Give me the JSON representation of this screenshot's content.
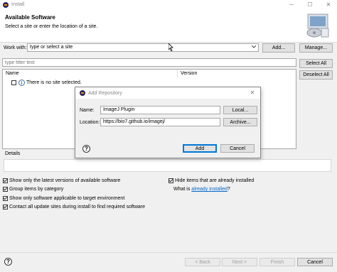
{
  "window": {
    "title": "Install",
    "minimize": "─",
    "maximize": "☐",
    "close": "✕"
  },
  "header": {
    "title": "Available Software",
    "subtitle": "Select a site or enter the location of a site."
  },
  "work_with": {
    "label": "Work with:",
    "value": "type or select a site",
    "add_button": "Add...",
    "manage_button": "Manage..."
  },
  "filter": {
    "placeholder": "type filter text"
  },
  "selection": {
    "select_all": "Select All",
    "deselect_all": "Deselect All"
  },
  "table": {
    "columns": [
      "Name",
      "Version"
    ],
    "empty_message": "There is no site selected."
  },
  "details": {
    "label": "Details"
  },
  "options": {
    "latest_versions": "Show only the latest versions of available software",
    "group_items": "Group items by category",
    "applicable_only": "Show only software applicable to target environment",
    "contact_sites": "Contact all update sites during install to find required software",
    "hide_installed": "Hide items that are already installed",
    "what_is": "What is",
    "already_installed_link": "already installed",
    "what_is_suffix": "?"
  },
  "footer": {
    "back": "< Back",
    "next": "Next >",
    "finish": "Finish",
    "cancel": "Cancel"
  },
  "dialog": {
    "title": "Add Repository",
    "close": "✕",
    "name_label": "Name:",
    "name_value": "ImageJ Plugin",
    "local_button": "Local...",
    "location_label": "Location:",
    "location_value": "https://bio7.github.io/imagej/",
    "archive_button": "Archive...",
    "add_button": "Add",
    "cancel_button": "Cancel",
    "help": "?"
  }
}
